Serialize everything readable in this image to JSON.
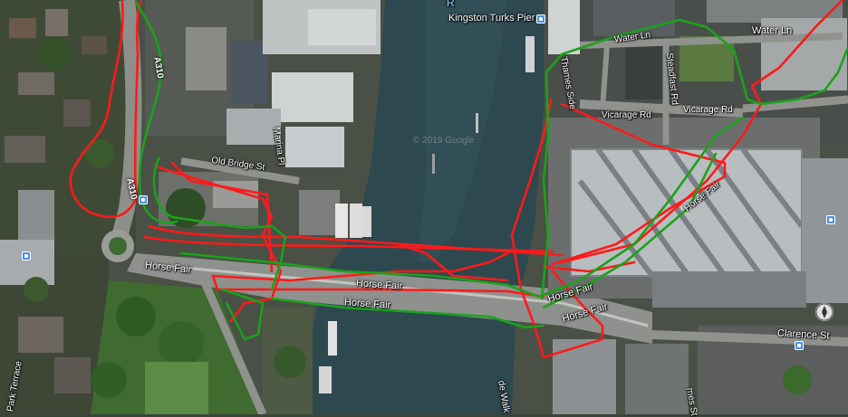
{
  "map": {
    "colors": {
      "route_red": "#ff1a1a",
      "route_green": "#1aa31a",
      "river": "#2f4a52",
      "roof_light": "#c9cdd0",
      "park": "#4e7a3a"
    },
    "labels": {
      "pier": "Kingston Turks Pier",
      "river_fragment": "R",
      "water_ln": "Water Ln",
      "water_ln_2": "Water Ln",
      "thames_side": "Thames Side",
      "steadfast_rd": "Steadfast Rd",
      "vicarage_rd": "Vicarage Rd",
      "vicarage_rd_2": "Vicarage Rd",
      "marina_pl": "Marina Pl",
      "old_bridge_st": "Old Bridge St",
      "a310_upper": "A310",
      "a310_lower": "A310",
      "horse_fair_left": "Horse Fair",
      "horse_fair_bridge_1": "Horse Fair",
      "horse_fair_bridge_2": "Horse Fair",
      "horse_fair_right_1": "Horse Fair",
      "horse_fair_right_2": "Horse Fair",
      "horse_fair_diag": "Horse Fair",
      "clarence_st": "Clarence St",
      "park_terrace": "Park Terrace",
      "riverside_walk": "de Walk",
      "james_st": "mes St",
      "copyright": "© 2019 Google"
    },
    "icons": {
      "pier_poi": "transit-icon",
      "left_poi": "transit-icon",
      "right_poi": "transit-icon",
      "clarence_poi": "transit-icon",
      "bridge_poi": "transit-icon",
      "compass": "compass-icon"
    }
  }
}
